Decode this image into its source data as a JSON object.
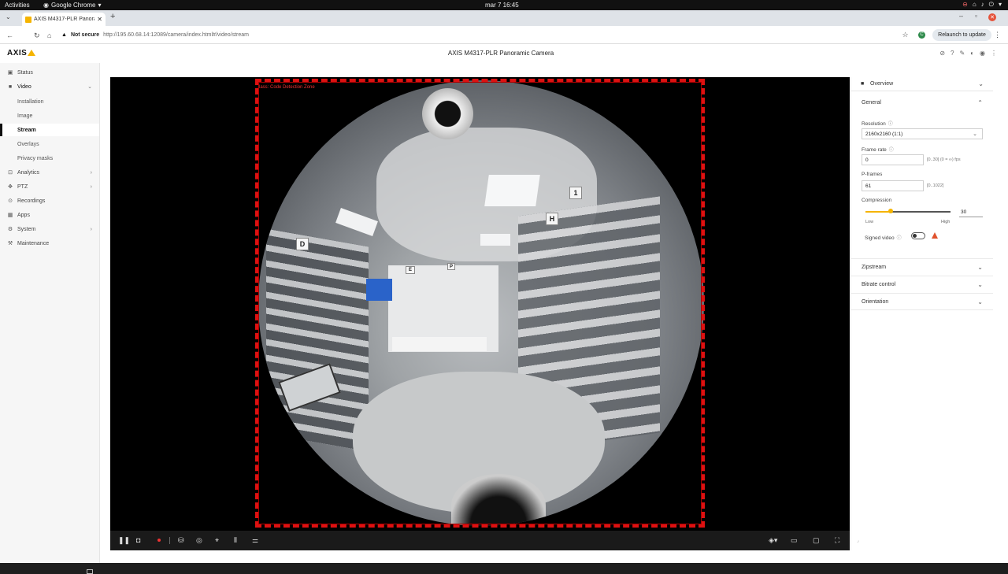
{
  "os": {
    "activities": "Activities",
    "app_name": "Google Chrome",
    "clock": "mar 7  16:45"
  },
  "browser": {
    "tab_title": "AXIS M4317-PLR Panora",
    "new_tab": "+",
    "not_secure": "Not secure",
    "url": "http://195.60.68.14:12089/camera/index.html#/video/stream",
    "profile_initial": "C",
    "relaunch_label": "Relaunch to update"
  },
  "header": {
    "logo": "AXIS",
    "title": "AXIS M4317-PLR Panoramic Camera"
  },
  "sidebar": {
    "items": [
      {
        "label": "Status",
        "icon": "status-icon"
      },
      {
        "label": "Video",
        "icon": "video-icon",
        "expanded": true
      },
      {
        "label": "Installation",
        "sub": true
      },
      {
        "label": "Image",
        "sub": true
      },
      {
        "label": "Stream",
        "sub": true,
        "active": true
      },
      {
        "label": "Overlays",
        "sub": true
      },
      {
        "label": "Privacy masks",
        "sub": true
      },
      {
        "label": "Analytics",
        "icon": "analytics-icon"
      },
      {
        "label": "PTZ",
        "icon": "ptz-icon"
      },
      {
        "label": "Recordings",
        "icon": "recordings-icon"
      },
      {
        "label": "Apps",
        "icon": "apps-icon"
      },
      {
        "label": "System",
        "icon": "system-icon"
      },
      {
        "label": "Maintenance",
        "icon": "maintenance-icon"
      }
    ]
  },
  "video": {
    "zone_label": "lass: Code Detection Zone",
    "signs": [
      "D",
      "H",
      "E",
      "P",
      "1"
    ]
  },
  "panel": {
    "overview": "Overview",
    "general": "General",
    "resolution_label": "Resolution",
    "resolution_value": "2160x2160 (1:1)",
    "framerate_label": "Frame rate",
    "framerate_value": "0",
    "framerate_hint": "[0..30] (0 = ∞) fps",
    "pframes_label": "P-frames",
    "pframes_value": "61",
    "pframes_hint": "[0..1022]",
    "compression_label": "Compression",
    "compression_value": "30",
    "compression_fraction": 0.3,
    "low": "Low",
    "high": "High",
    "signed_video_label": "Signed video",
    "signed_video_on": false,
    "sections": [
      "Zipstream",
      "Bitrate control",
      "Orientation"
    ]
  },
  "colors": {
    "accent": "#f5b400",
    "zone": "#dd1111",
    "warning": "#e0522d"
  }
}
